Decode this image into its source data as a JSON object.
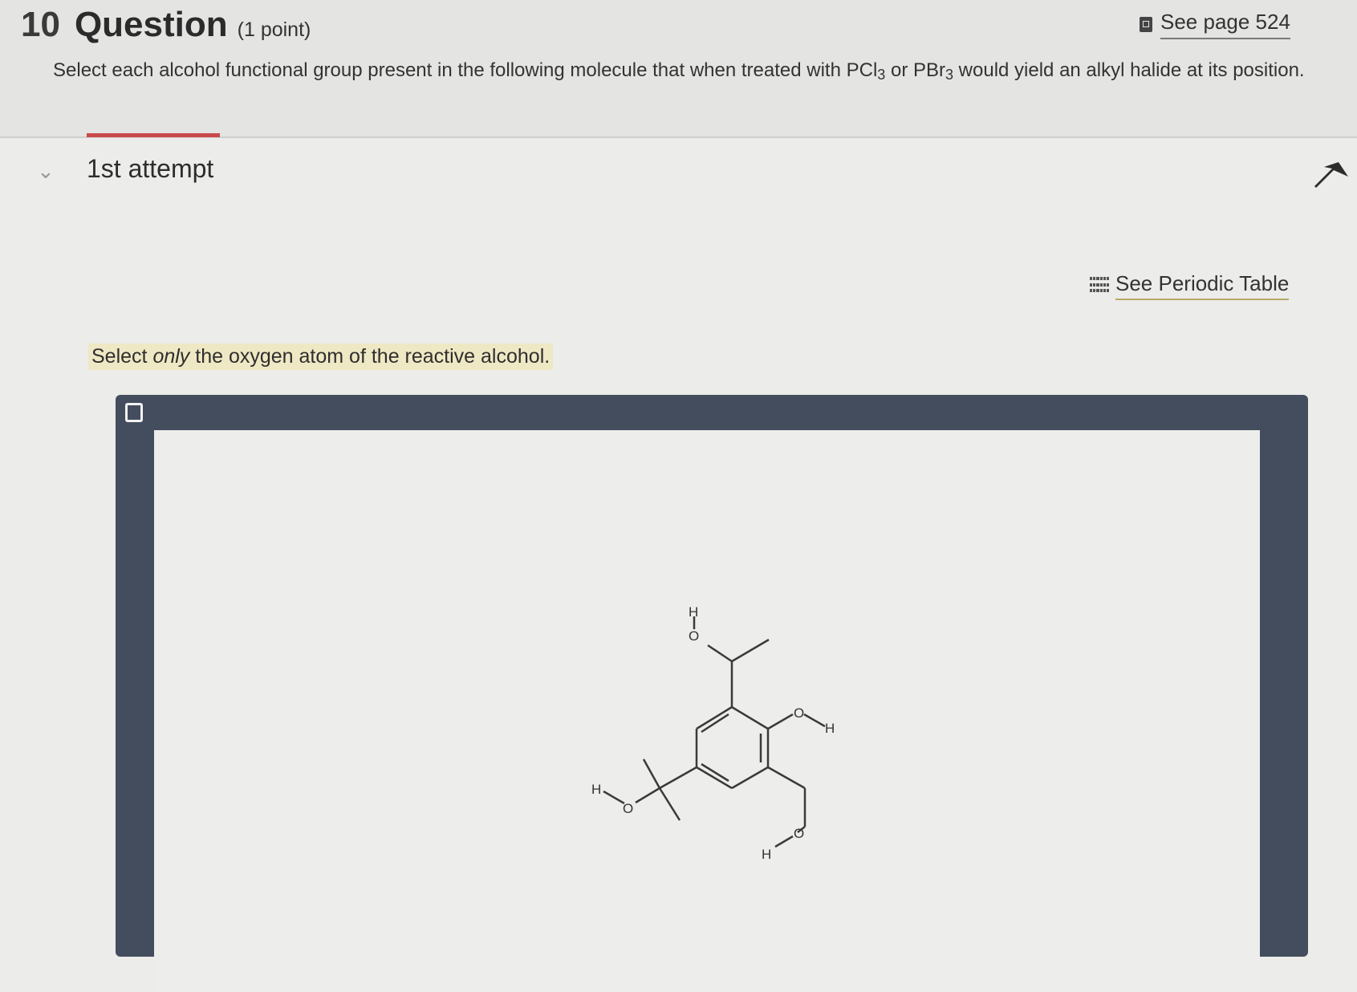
{
  "question": {
    "number": "10",
    "title": "Question",
    "points": "(1 point)",
    "see_page": "See page 524",
    "prompt_parts": [
      "Select each alcohol functional group present in the following molecule that when treated with PCl",
      "3",
      " or PBr",
      "3",
      " would yield an alkyl halide at its position."
    ]
  },
  "attempt": {
    "label": "1st attempt",
    "periodic_table_link": "See Periodic Table",
    "instruction_parts": [
      "Select ",
      "only",
      " the oxygen atom of the reactive alcohol."
    ]
  },
  "molecule": {
    "atoms": {
      "o_top": "O",
      "h_top": "H",
      "o_right": "O",
      "h_right": "H",
      "o_left": "O",
      "h_left": "H",
      "o_bottom": "O",
      "h_bottom": "H"
    }
  },
  "colors": {
    "accent": "#c94a4a",
    "frame": "#434d5e",
    "highlight": "#efe8c4"
  }
}
